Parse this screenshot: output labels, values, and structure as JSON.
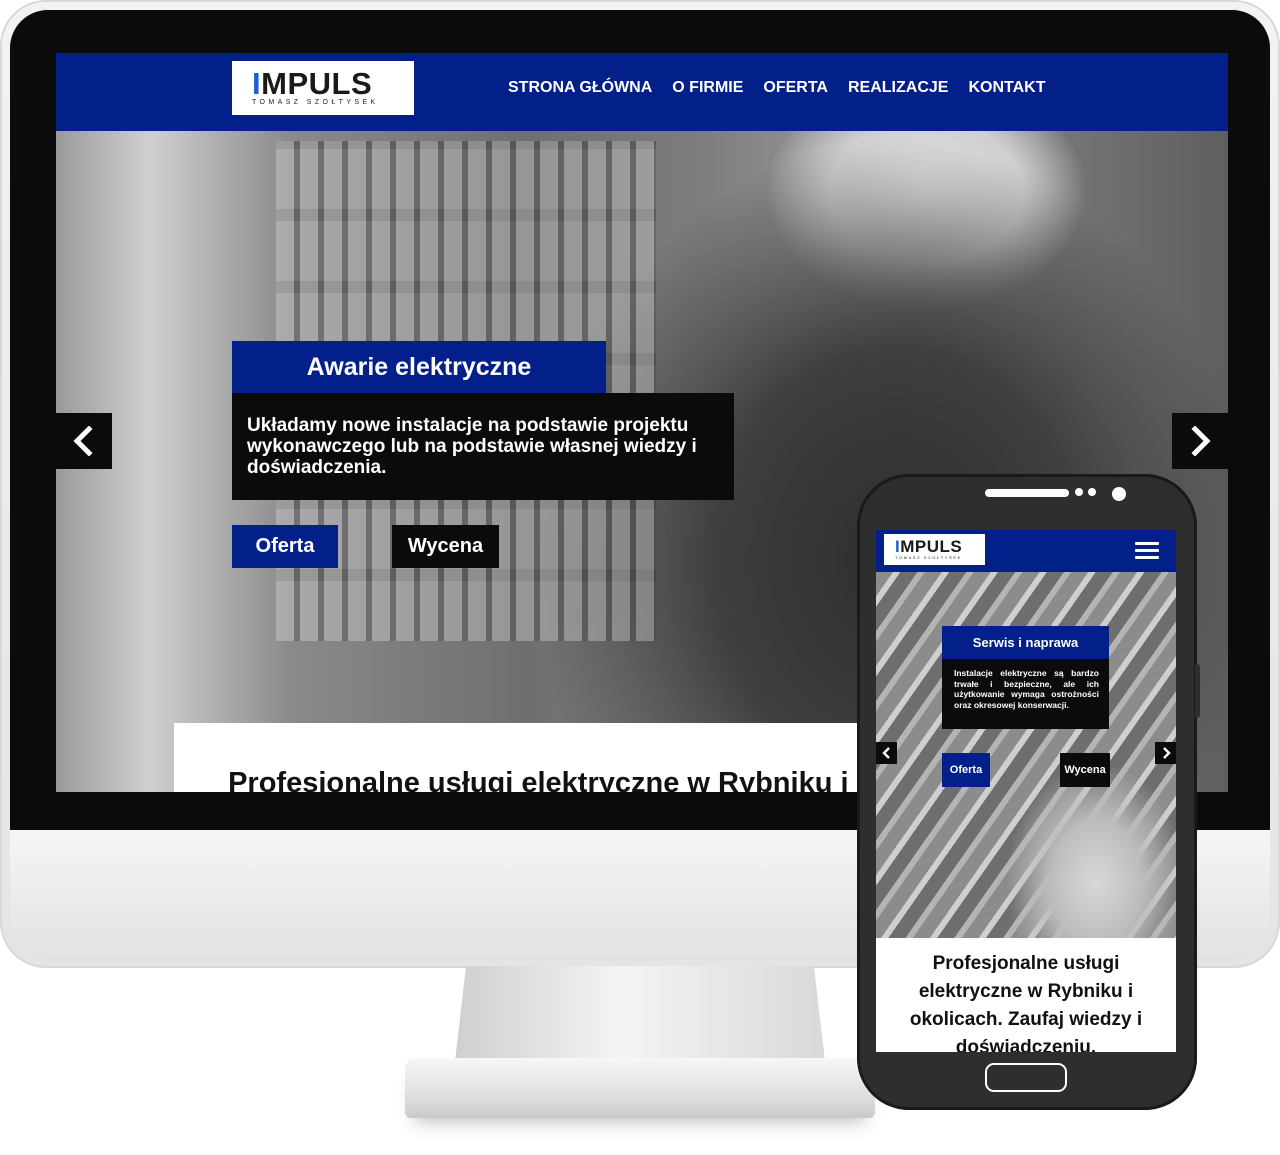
{
  "desktop": {
    "logo": {
      "word_i": "I",
      "word_rest": "MPULS",
      "subtitle": "TOMASZ SZOŁTYSEK"
    },
    "nav": [
      {
        "label": "STRONA GŁÓWNA"
      },
      {
        "label": "O FIRMIE"
      },
      {
        "label": "OFERTA"
      },
      {
        "label": "REALIZACJE"
      },
      {
        "label": "KONTAKT"
      }
    ],
    "slide": {
      "title": "Awarie elektryczne",
      "text": "Układamy nowe instalacje na podstawie projektu wykonawczego lub na podstawie własnej wiedzy i doświadczenia.",
      "button_primary": "Oferta",
      "button_secondary": "Wycena"
    },
    "intro": {
      "text": "Profesjonalne usługi elektryczne w Rybniku i okolicach. Zaufaj wiedzy i doświadczeniu."
    }
  },
  "mobile": {
    "logo": {
      "word_i": "I",
      "word_rest": "MPULS",
      "subtitle": "TOMASZ SZOŁTYSEK"
    },
    "slide": {
      "title": "Serwis i naprawa",
      "text": "Instalacje elektryczne są bardzo trwałe i bezpieczne, ale ich użytkowanie wymaga ostrożności oraz okresowej konserwacji.",
      "button_primary": "Oferta",
      "button_secondary": "Wycena"
    },
    "intro": {
      "text": "Profesjonalne usługi elektryczne w Rybniku i okolicach. Zaufaj wiedzy i doświadczeniu."
    }
  },
  "icons": {
    "prev": "chevron-left-icon",
    "next": "chevron-right-icon",
    "menu": "hamburger-menu-icon"
  },
  "colors": {
    "brand_blue": "#03208a",
    "logo_accent": "#1d5fd1",
    "dark_box": "#0b0b0b"
  }
}
